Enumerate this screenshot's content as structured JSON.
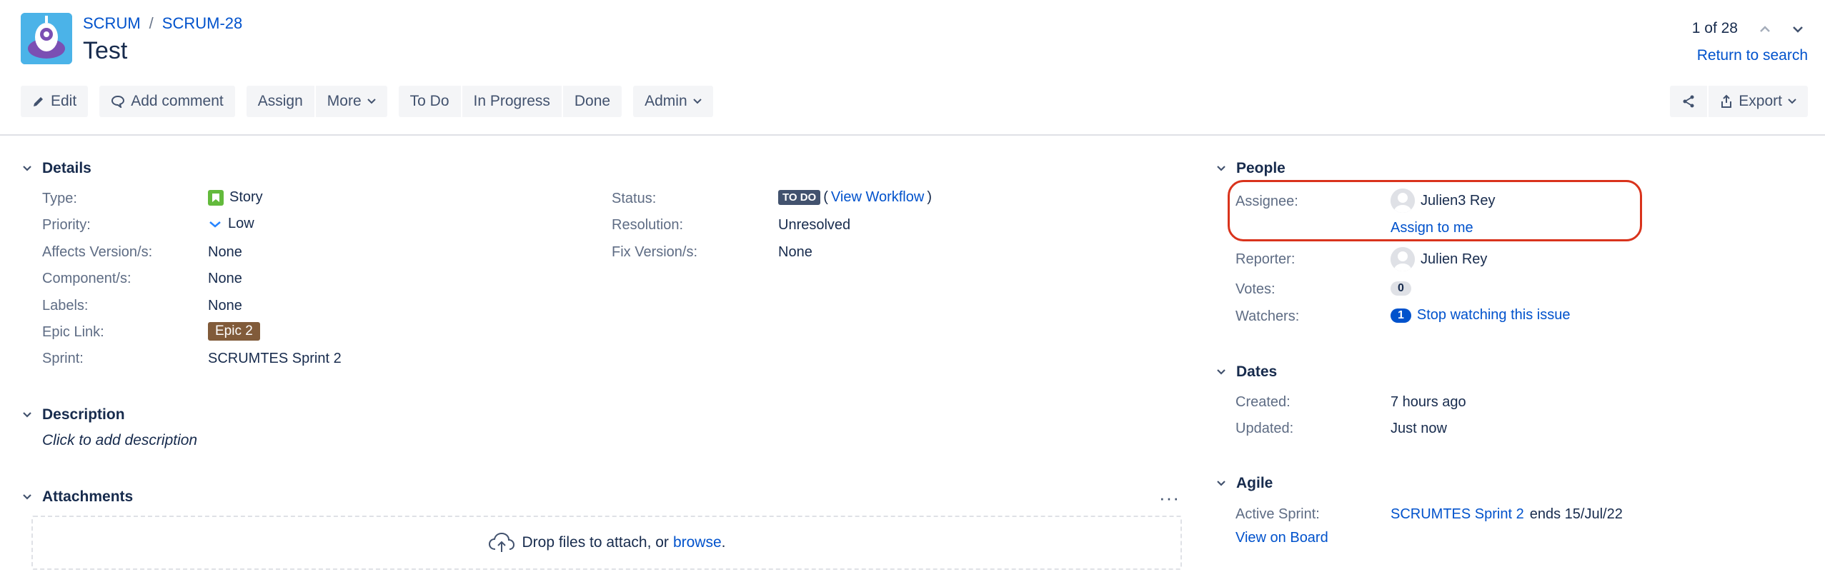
{
  "breadcrumb": {
    "project": "SCRUM",
    "separator": "/",
    "issue_key": "SCRUM-28"
  },
  "issue": {
    "title": "Test"
  },
  "pager": {
    "position": "1 of 28",
    "return_label": "Return to search"
  },
  "toolbar": {
    "edit": "Edit",
    "add_comment": "Add comment",
    "assign": "Assign",
    "more": "More",
    "to_do": "To Do",
    "in_progress": "In Progress",
    "done": "Done",
    "admin": "Admin",
    "export": "Export"
  },
  "details": {
    "heading": "Details",
    "type_label": "Type:",
    "type_value": "Story",
    "priority_label": "Priority:",
    "priority_value": "Low",
    "affects_label": "Affects Version/s:",
    "affects_value": "None",
    "component_label": "Component/s:",
    "component_value": "None",
    "labels_label": "Labels:",
    "labels_value": "None",
    "epic_label": "Epic Link:",
    "epic_value": "Epic 2",
    "sprint_label": "Sprint:",
    "sprint_value": "SCRUMTES Sprint 2",
    "status_label": "Status:",
    "status_value": "TO DO",
    "workflow_open": "(",
    "workflow_link": "View Workflow",
    "workflow_close": ")",
    "resolution_label": "Resolution:",
    "resolution_value": "Unresolved",
    "fix_label": "Fix Version/s:",
    "fix_value": "None"
  },
  "description": {
    "heading": "Description",
    "placeholder": "Click to add description"
  },
  "attachments": {
    "heading": "Attachments",
    "more": "···",
    "drop_text": "Drop files to attach, or",
    "browse": "browse",
    "period": "."
  },
  "people": {
    "heading": "People",
    "assignee_label": "Assignee:",
    "assignee_value": "Julien3 Rey",
    "assign_to_me": "Assign to me",
    "reporter_label": "Reporter:",
    "reporter_value": "Julien Rey",
    "votes_label": "Votes:",
    "votes_value": "0",
    "watchers_label": "Watchers:",
    "watchers_value": "1",
    "stop_watching": "Stop watching this issue"
  },
  "dates": {
    "heading": "Dates",
    "created_label": "Created:",
    "created_value": "7 hours ago",
    "updated_label": "Updated:",
    "updated_value": "Just now"
  },
  "agile": {
    "heading": "Agile",
    "active_sprint_label": "Active Sprint:",
    "active_sprint_link": "SCRUMTES Sprint 2",
    "active_sprint_end": "ends 15/Jul/22",
    "view_on_board": "View on Board"
  },
  "colors": {
    "link": "#0052cc",
    "highlight": "#d9331c",
    "epic": "#815b3a",
    "status": "#42526e"
  }
}
